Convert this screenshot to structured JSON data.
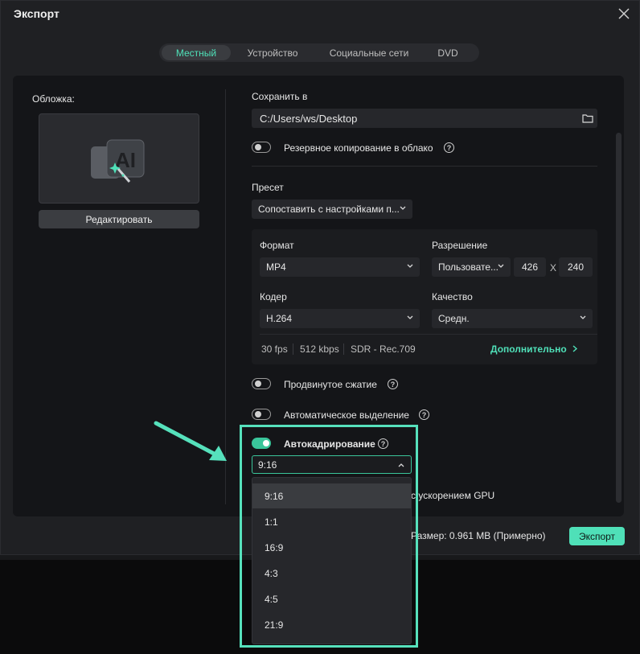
{
  "window": {
    "title": "Экспорт"
  },
  "tabs": [
    "Местный",
    "Устройство",
    "Социальные сети",
    "DVD"
  ],
  "cover": {
    "label": "Обложка:",
    "edit_button": "Редактировать"
  },
  "save": {
    "label": "Сохранить в",
    "path": "C:/Users/ws/Desktop"
  },
  "cloud_backup": {
    "label": "Резервное копирование в облако",
    "enabled": false
  },
  "preset": {
    "label": "Пресет",
    "value": "Сопоставить с настройками п..."
  },
  "format": {
    "label": "Формат",
    "value": "MP4"
  },
  "resolution": {
    "label": "Разрешение",
    "value": "Пользовате...",
    "width": "426",
    "x_sep": "X",
    "height": "240"
  },
  "encoder": {
    "label": "Кодер",
    "value": "H.264"
  },
  "quality": {
    "label": "Качество",
    "value": "Средн."
  },
  "stats": {
    "fps": "30 fps",
    "bitrate": "512 kbps",
    "color": "SDR - Rec.709",
    "more": "Дополнительно"
  },
  "advanced_compression": {
    "label": "Продвинутое сжатие",
    "enabled": false
  },
  "auto_highlight": {
    "label": "Автоматическое выделение",
    "enabled": false
  },
  "auto_reframe": {
    "label": "Автокадрирование",
    "enabled": true,
    "selected": "9:16",
    "options": [
      "9:16",
      "1:1",
      "16:9",
      "4:3",
      "4:5",
      "21:9"
    ]
  },
  "gpu": {
    "label_tail": "с ускорением GPU"
  },
  "footer": {
    "size": "Размер: 0.961 MB (Примерно)",
    "export_button": "Экспорт"
  },
  "colors": {
    "accent": "#4fe0b8",
    "toggle_on": "#3ac59a",
    "highlight_box": "#56e1bc"
  },
  "help_glyph": "?"
}
